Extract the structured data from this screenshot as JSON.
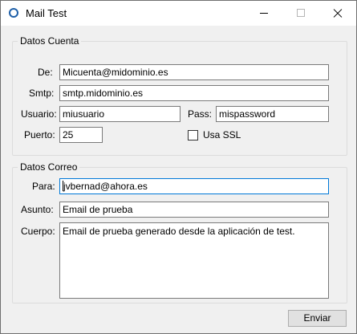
{
  "window": {
    "title": "Mail Test"
  },
  "cuenta": {
    "legend": "Datos Cuenta",
    "de_label": "De:",
    "de_value": "Micuenta@midominio.es",
    "smtp_label": "Smtp:",
    "smtp_value": "smtp.midominio.es",
    "usuario_label": "Usuario:",
    "usuario_value": "miusuario",
    "pass_label": "Pass:",
    "pass_value": "mispassword",
    "puerto_label": "Puerto:",
    "puerto_value": "25",
    "ssl_label": "Usa SSL",
    "ssl_checked": false
  },
  "correo": {
    "legend": "Datos Correo",
    "para_label": "Para:",
    "para_value": "jvbernad@ahora.es",
    "asunto_label": "Asunto:",
    "asunto_value": "Email de prueba",
    "cuerpo_label": "Cuerpo:",
    "cuerpo_value": "Email de prueba generado desde la aplicación de test."
  },
  "actions": {
    "send_label": "Enviar"
  }
}
